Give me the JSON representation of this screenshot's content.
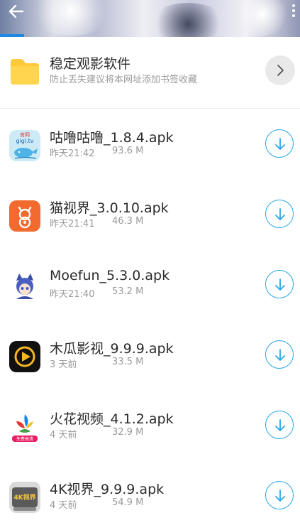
{
  "folder": {
    "title": "稳定观影软件",
    "subtitle": "防止丢失建议将本网址添加书签收藏"
  },
  "download_progress": 0.08,
  "files": [
    {
      "name": "咕噜咕噜_1.8.4.apk",
      "date": "昨天21:42",
      "size": "93.6 M",
      "icon": "whale-app-icon",
      "icon_text_top": "官网",
      "icon_text": "gigl.tv"
    },
    {
      "name": "猫视界_3.0.10.apk",
      "date": "昨天21:41",
      "size": "46.3 M",
      "icon": "cat-film-app-icon"
    },
    {
      "name": "Moefun_5.3.0.apk",
      "date": "昨天21:40",
      "size": "53.2 M",
      "icon": "anime-girl-app-icon"
    },
    {
      "name": "木瓜影视_9.9.9.apk",
      "date": "3 天前",
      "size": "33.5 M",
      "icon": "play-button-app-icon"
    },
    {
      "name": "火花视频_4.1.2.apk",
      "date": "4 天前",
      "size": "32.9 M",
      "icon": "spark-app-icon",
      "icon_text": "免费高清"
    },
    {
      "name": "4K视界_9.9.9.apk",
      "date": "4 天前",
      "size": "54.9 M",
      "icon": "4k-app-icon",
      "icon_text": "4K视界"
    }
  ],
  "colors": {
    "accent": "#2aa7e6",
    "folder": "#ffc93c",
    "progress": "#1e88e5"
  }
}
